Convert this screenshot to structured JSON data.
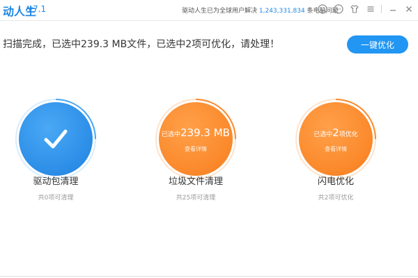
{
  "titlebar": {
    "app_name": "动人生",
    "version": "v7.1",
    "solved_prefix": "驱动人生已为全球用户解决",
    "solved_count": "1,243,331,834",
    "solved_suffix": "条电脑问题",
    "icons": [
      "smiley-icon",
      "message-icon",
      "shirt-icon",
      "menu-icon",
      "minimize-icon",
      "close-icon"
    ]
  },
  "status": {
    "text": "扫描完成，已选中239.3 MB文件，已选中2项可优化，请处理！"
  },
  "optimize_button": {
    "label": "一键优化"
  },
  "colors": {
    "accent_blue": "#2196f3",
    "orange": "#fb8a2c"
  },
  "cards": [
    {
      "title": "驱动包清理",
      "subtitle": "共0项可清理",
      "icon": "check-icon"
    },
    {
      "title": "垃圾文件清理",
      "subtitle": "共25项可清理",
      "circle_prefix": "已选中",
      "circle_value": "239.3 MB",
      "circle_link": "查看详情"
    },
    {
      "title": "闪电优化",
      "subtitle": "共2项可优化",
      "circle_prefix": "已选中",
      "circle_value": "2",
      "circle_suffix": "项优化",
      "circle_link": "查看详情"
    }
  ]
}
